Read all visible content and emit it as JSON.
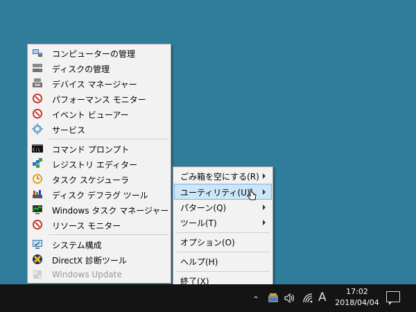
{
  "tools_menu": {
    "items": [
      {
        "label": "コンピューターの管理",
        "icon": "computer-management-icon"
      },
      {
        "label": "ディスクの管理",
        "icon": "disk-management-icon"
      },
      {
        "label": "デバイス マネージャー",
        "icon": "device-manager-icon"
      },
      {
        "label": "パフォーマンス モニター",
        "icon": "performance-monitor-icon"
      },
      {
        "label": "イベント ビューアー",
        "icon": "event-viewer-icon"
      },
      {
        "label": "サービス",
        "icon": "services-icon"
      },
      {
        "label": "コマンド プロンプト",
        "icon": "command-prompt-icon"
      },
      {
        "label": "レジストリ エディター",
        "icon": "registry-editor-icon"
      },
      {
        "label": "タスク スケジューラ",
        "icon": "task-scheduler-icon"
      },
      {
        "label": "ディスク デフラグ ツール",
        "icon": "defrag-icon"
      },
      {
        "label": "Windows タスク マネージャー",
        "icon": "task-manager-icon"
      },
      {
        "label": "リソース モニター",
        "icon": "resource-monitor-icon"
      },
      {
        "label": "システム構成",
        "icon": "system-configuration-icon"
      },
      {
        "label": "DirectX 診断ツール",
        "icon": "directx-icon"
      },
      {
        "label": "Windows Update",
        "icon": "windows-update-icon"
      }
    ]
  },
  "main_menu": {
    "items": [
      {
        "label": "ごみ箱を空にする(R)"
      },
      {
        "label": "ユーティリティ(U)"
      },
      {
        "label": "パターン(Q)"
      },
      {
        "label": "ツール(T)"
      },
      {
        "label": "オプション(O)"
      },
      {
        "label": "ヘルプ(H)"
      },
      {
        "label": "終了(X)"
      }
    ]
  },
  "taskbar": {
    "time": "17:02",
    "date": "2018/04/04",
    "ime": "A"
  },
  "colors": {
    "desktop": "#2f7c9b",
    "taskbar": "#141414",
    "highlight": "#cde6f7"
  }
}
